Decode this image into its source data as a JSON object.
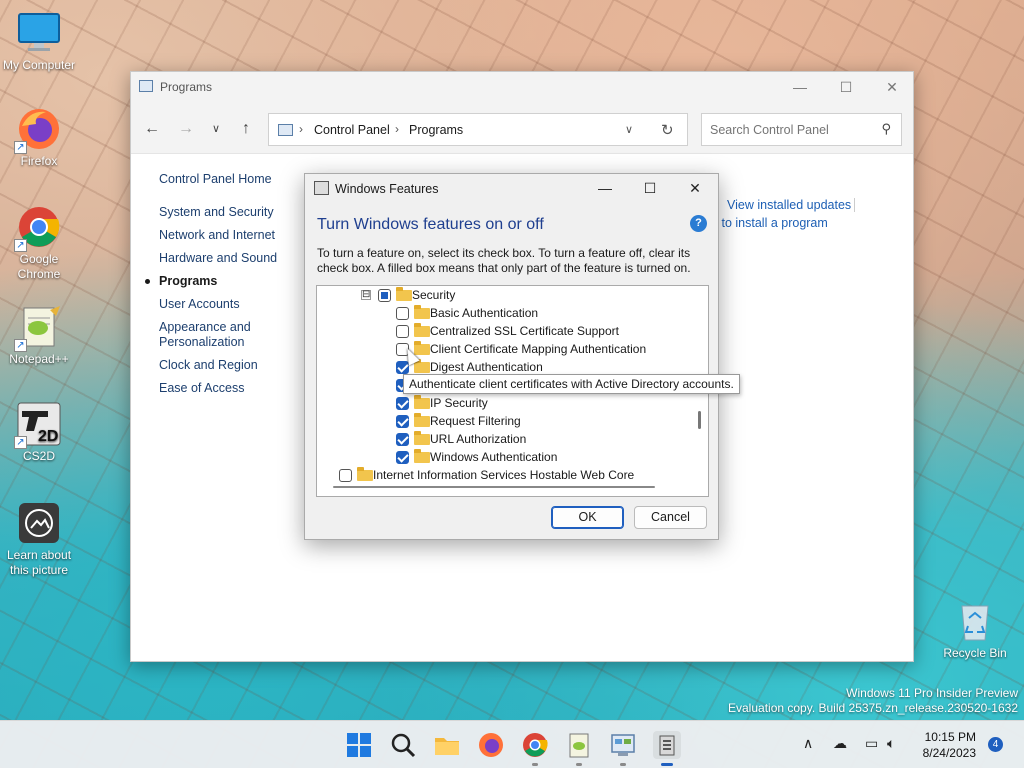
{
  "desktop": {
    "icons": [
      {
        "label": "My Computer",
        "icon": "monitor-icon"
      },
      {
        "label": "Firefox",
        "icon": "firefox-icon"
      },
      {
        "label": "Google Chrome",
        "icon": "chrome-icon"
      },
      {
        "label": "Notepad++",
        "icon": "notepad-plus-plus-icon"
      },
      {
        "label": "CS2D",
        "icon": "cs2d-icon"
      },
      {
        "label": "Learn about this picture",
        "icon": "camera-icon"
      },
      {
        "label": "Recycle Bin",
        "icon": "recycle-bin-icon"
      }
    ],
    "watermark": {
      "line1": "Windows 11 Pro Insider Preview",
      "line2": "Evaluation copy. Build 25375.zn_release.230520-1632"
    }
  },
  "control_panel": {
    "title": "Programs",
    "breadcrumbs": [
      "Control Panel",
      "Programs"
    ],
    "search_placeholder": "Search Control Panel",
    "sidebar": [
      {
        "label": "Control Panel Home"
      },
      {
        "label": "System and Security"
      },
      {
        "label": "Network and Internet"
      },
      {
        "label": "Hardware and Sound"
      },
      {
        "label": "Programs",
        "active": true
      },
      {
        "label": "User Accounts"
      },
      {
        "label": "Appearance and Personalization"
      },
      {
        "label": "Clock and Region"
      },
      {
        "label": "Ease of Access"
      }
    ],
    "right_links": {
      "view_updates": "View installed updates",
      "install_program": "w to install a program"
    }
  },
  "windows_features": {
    "title": "Windows Features",
    "heading": "Turn Windows features on or off",
    "help": "?",
    "description": "To turn a feature on, select its check box. To turn a feature off, clear its check box. A filled box means that only part of the feature is turned on.",
    "tree": [
      {
        "label": "Security",
        "state": "partial",
        "expander": "⊟"
      },
      {
        "label": "Basic Authentication",
        "state": "unchecked"
      },
      {
        "label": "Centralized SSL Certificate Support",
        "state": "unchecked"
      },
      {
        "label": "Client Certificate Mapping Authentication",
        "state": "unchecked"
      },
      {
        "label": "Digest Authentication",
        "state": "checked"
      },
      {
        "label": "",
        "state": "checked"
      },
      {
        "label": "IP Security",
        "state": "checked"
      },
      {
        "label": "Request Filtering",
        "state": "checked"
      },
      {
        "label": "URL Authorization",
        "state": "checked"
      },
      {
        "label": "Windows Authentication",
        "state": "checked"
      },
      {
        "label": "Internet Information Services Hostable Web Core",
        "state": "unchecked"
      }
    ],
    "tooltip": "Authenticate client certificates with Active Directory accounts.",
    "ok_label": "OK",
    "cancel_label": "Cancel"
  },
  "taskbar": {
    "apps": [
      "windows-start-icon",
      "search-icon",
      "file-explorer-icon",
      "firefox-icon",
      "chrome-icon",
      "notepad-plus-plus-icon",
      "control-panel-icon",
      "windows-features-icon"
    ],
    "time": "10:15 PM",
    "date": "8/24/2023",
    "notification_count": "4"
  }
}
